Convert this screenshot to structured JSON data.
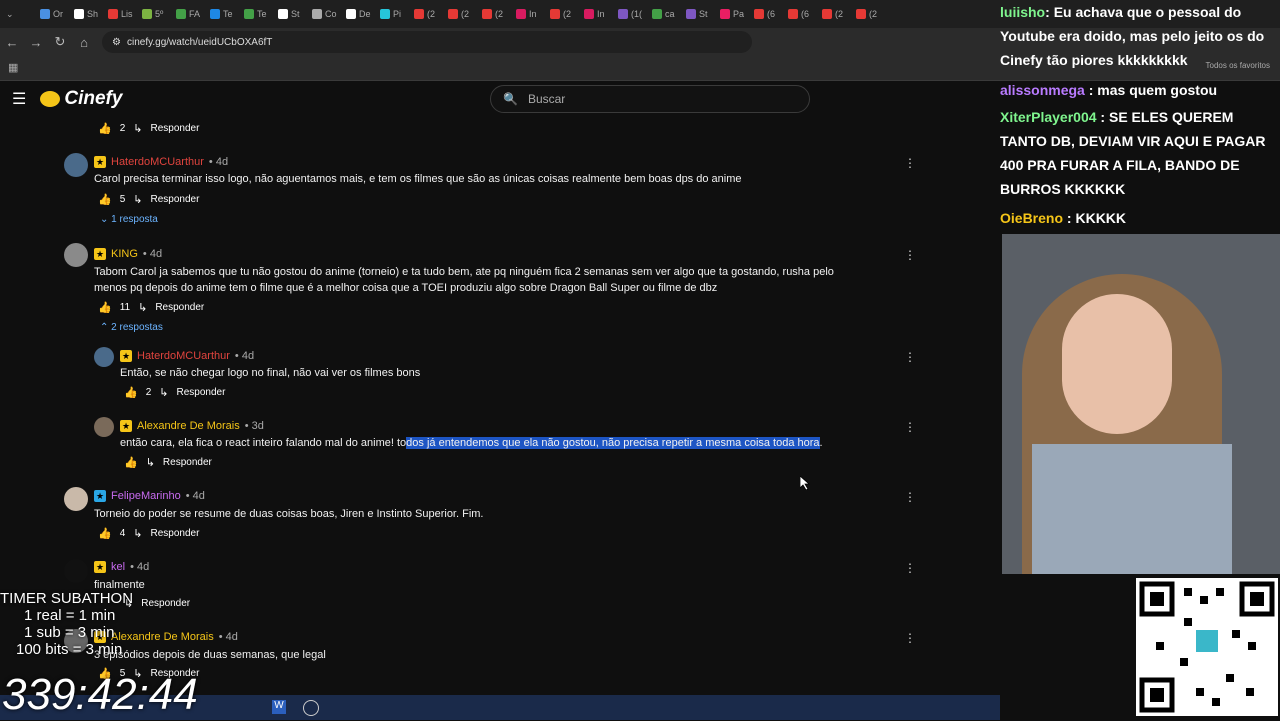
{
  "browser": {
    "tabs": [
      "Or",
      "Sh",
      "Lis",
      "5º",
      "FA",
      "Te",
      "Te",
      "St",
      "Co",
      "De",
      "Pi",
      "(2",
      "(2",
      "(2",
      "In",
      "(2",
      "In",
      "(1(",
      "ca",
      "St",
      "Pa",
      "(6",
      "(6",
      "(2",
      "(2"
    ],
    "url": "cinefy.gg/watch/ueidUCbOXA6fT",
    "favorites_label": "Todos os favoritos"
  },
  "site": {
    "name": "Cinefy",
    "search_placeholder": "Buscar"
  },
  "comments": [
    {
      "likes": "2",
      "reply": "Responder"
    },
    {
      "user": "HaterdoMCUarthur",
      "age": "4d",
      "text": "Carol precisa terminar isso logo, não aguentamos mais, e tem os filmes que são as únicas coisas realmente bem boas dps do anime",
      "likes": "5",
      "reply": "Responder",
      "toggle": "1 resposta"
    },
    {
      "user": "KING",
      "age": "4d",
      "text1": "Tabom Carol ja sabemos que tu não gostou do anime (torneio) e ta tudo bem, ate pq ninguém fica 2 semanas sem ver algo que ta gostando, rusha pelo",
      "text2": "menos pq depois do anime tem o filme que é a melhor coisa que a TOEI produziu algo sobre Dragon Ball Super ou filme de dbz",
      "likes": "11",
      "reply": "Responder",
      "toggle": "2 respostas"
    },
    {
      "user": "HaterdoMCUarthur",
      "age": "4d",
      "text": "Então, se não chegar logo no final, não vai ver os filmes bons",
      "likes": "2",
      "reply": "Responder"
    },
    {
      "user": "Alexandre De Morais",
      "age": "3d",
      "text_plain": "então cara, ela fica o react inteiro falando mal do anime! to",
      "text_hl": "dos já entendemos que ela não gostou, não precisa repetir a mesma coisa toda hora",
      "text_end": ".",
      "reply": "Responder"
    },
    {
      "user": "FelipeMarinho",
      "age": "4d",
      "text": "Torneio do poder se resume de duas coisas boas, Jiren e Instinto Superior. Fim.",
      "likes": "4",
      "reply": "Responder"
    },
    {
      "user": "kel",
      "age": "4d",
      "text": "finalmente",
      "reply": "Responder"
    },
    {
      "user": "Alexandre De Morais",
      "age": "4d",
      "text": "3 episódios depois de duas semanas, que legal",
      "likes": "5",
      "reply": "Responder"
    }
  ],
  "chat": [
    {
      "user": "luiisho",
      "text": "Eu achava que o pessoal do Youtube era doido, mas pelo jeito os do Cinefy tão piores kkkkkkkkk"
    },
    {
      "user": "alissonmega",
      "text": "mas quem gostou"
    },
    {
      "user": "XiterPlayer004",
      "text": "SE ELES QUEREM TANTO DB, DEVIAM VIR AQUI E PAGAR 400 PRA FURAR A FILA, BANDO DE BURROS KKKKKK"
    },
    {
      "user": "OieBreno",
      "text": "KKKKK"
    }
  ],
  "overlay": {
    "title": "TIMER SUBATHON",
    "l1": "1 real = 1 min",
    "l2": "1 sub = 3 min",
    "l3": "100 bits = 3 min",
    "timer": "339:42:44"
  },
  "colors": {
    "user_red": "#e0443e",
    "user_gold": "#f5c518",
    "user_purple": "#c86bf0",
    "chat_gold": "#f5c518",
    "chat_purple": "#b97bff",
    "chat_green": "#7ff58e",
    "highlight": "#1d55c4"
  }
}
